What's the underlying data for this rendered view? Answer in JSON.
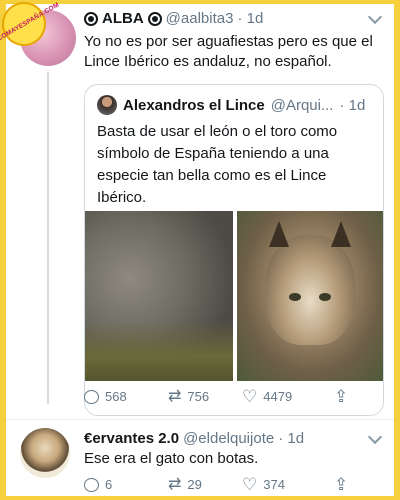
{
  "watermark": "ASCOMAYESPAÑA.COM",
  "tweet1": {
    "name": "ALBA",
    "handle": "@aalbita3",
    "time": "· 1d",
    "text": "Yo no es por ser aguafiestas pero es que el Lince Ibérico es andaluz, no español."
  },
  "quote": {
    "name": "Alexandros el Lince",
    "handle": "@Arqui...",
    "time": "· 1d",
    "text": "Basta de usar el león o el toro como símbolo de España teniendo a una especie tan bella como es el Lince Ibérico."
  },
  "tweet1_actions": {
    "replies": "568",
    "retweets": "756",
    "likes": "4479"
  },
  "tweet2": {
    "name": "€ervantes 2.0",
    "handle": "@eldelquijote",
    "time": "· 1d",
    "text": "Ese era el gato con botas."
  },
  "tweet2_actions": {
    "replies": "6",
    "retweets": "29",
    "likes": "374"
  },
  "icons": {
    "reply": "reply-icon",
    "retweet": "retweet-icon",
    "like": "heart-icon",
    "share": "share-icon",
    "more": "chevron-down-icon"
  }
}
